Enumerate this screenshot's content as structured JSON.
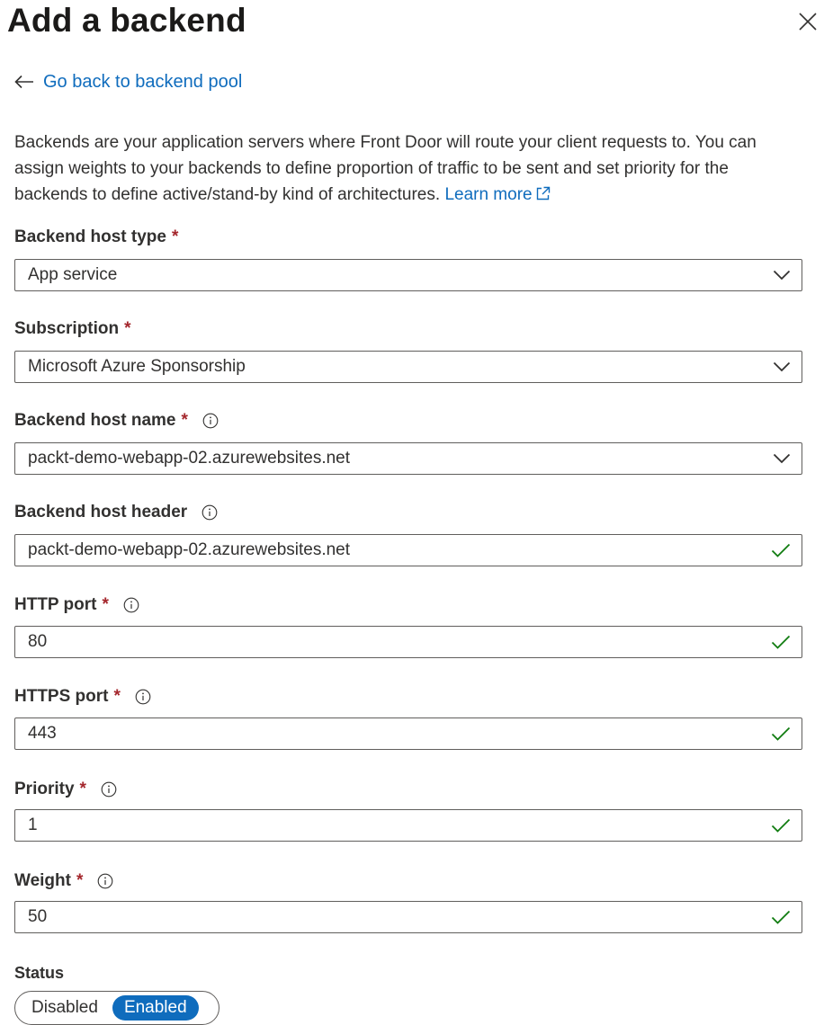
{
  "panel": {
    "title": "Add a backend",
    "close_icon": "close-icon",
    "back_link": "Go back to backend pool",
    "description": "Backends are your application servers where Front Door will route your client requests to. You can assign weights to your backends to define proportion of traffic to be sent and set priority for the backends to define active/stand-by kind of architectures.",
    "learn_more": "Learn more"
  },
  "fields": {
    "backend_host_type": {
      "label": "Backend host type",
      "required": "*",
      "value": "App service",
      "control": "dropdown"
    },
    "subscription": {
      "label": "Subscription",
      "required": "*",
      "value": "Microsoft Azure Sponsorship",
      "control": "dropdown"
    },
    "backend_host_name": {
      "label": "Backend host name",
      "required": "*",
      "value": "packt-demo-webapp-02.azurewebsites.net",
      "control": "dropdown"
    },
    "backend_host_header": {
      "label": "Backend host header",
      "value": "packt-demo-webapp-02.azurewebsites.net",
      "control": "text-valid"
    },
    "http_port": {
      "label": "HTTP port",
      "required": "*",
      "value": "80",
      "control": "text-valid"
    },
    "https_port": {
      "label": "HTTPS port",
      "required": "*",
      "value": "443",
      "control": "text-valid"
    },
    "priority": {
      "label": "Priority",
      "required": "*",
      "value": "1",
      "control": "text-valid"
    },
    "weight": {
      "label": "Weight",
      "required": "*",
      "value": "50",
      "control": "text-valid"
    }
  },
  "status": {
    "label": "Status",
    "options": [
      "Disabled",
      "Enabled"
    ],
    "selected": "Enabled"
  },
  "colors": {
    "link": "#0f6cbd",
    "required": "#a4262c",
    "valid_check": "#107c10",
    "toggle_on": "#0f6cbd"
  }
}
